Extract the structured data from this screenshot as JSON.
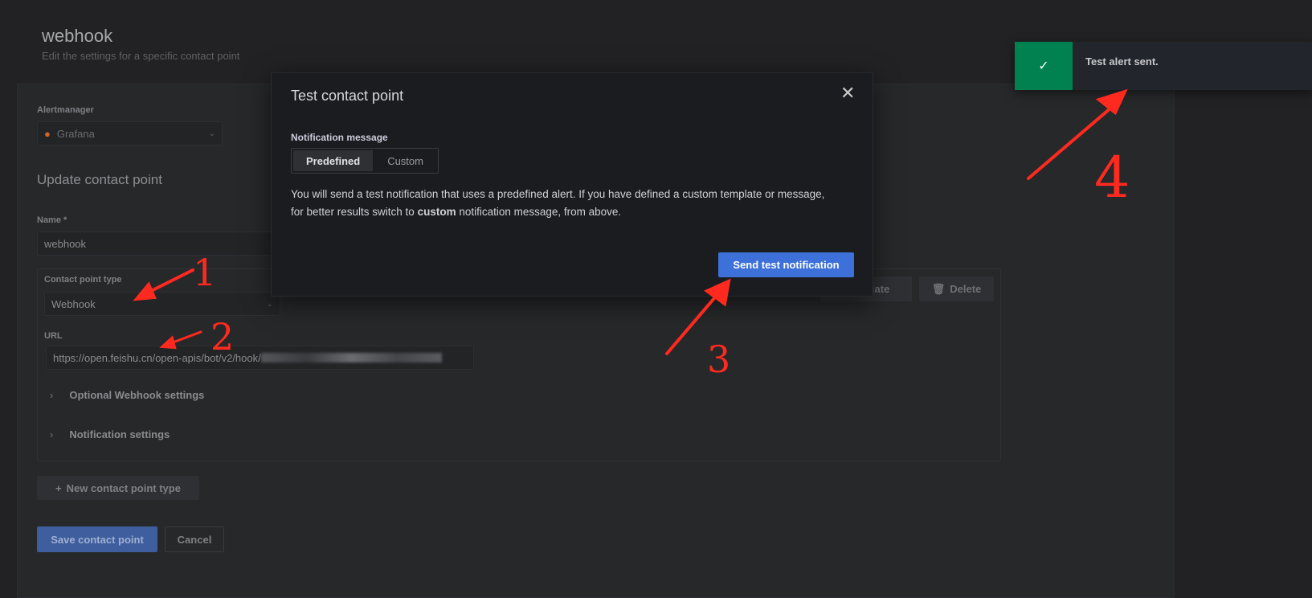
{
  "page": {
    "title": "webhook",
    "subtitle": "Edit the settings for a specific contact point"
  },
  "form": {
    "alertmanager_label": "Alertmanager",
    "alertmanager_value": "Grafana",
    "section_title": "Update contact point",
    "name_label": "Name *",
    "name_value": "webhook",
    "type_label": "Contact point type",
    "type_value": "Webhook",
    "url_label": "URL",
    "url_value": "https://open.feishu.cn/open-apis/bot/v2/hook/",
    "optional_settings": "Optional Webhook settings",
    "notification_settings": "Notification settings",
    "duplicate": "Duplicate",
    "delete": "Delete",
    "new_type": "New contact point type",
    "save": "Save contact point",
    "cancel": "Cancel"
  },
  "modal": {
    "title": "Test contact point",
    "message_label": "Notification message",
    "options": [
      "Predefined",
      "Custom"
    ],
    "selected": "Predefined",
    "text_1": "You will send a test notification that uses a predefined alert. If you have defined a custom template or message, for better results switch to ",
    "text_bold": "custom",
    "text_2": " notification message, from above.",
    "send": "Send test notification"
  },
  "toast": {
    "message": "Test alert sent.",
    "color": "#00814f"
  },
  "annotations": [
    "1",
    "2",
    "3",
    "4"
  ]
}
